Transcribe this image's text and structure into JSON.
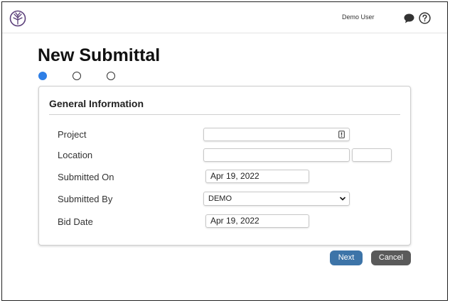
{
  "header": {
    "logo_icon": "tree-logo-icon",
    "user_name": "Demo User",
    "chat_icon": "speech-bubble-icon",
    "help_icon": "question-circle-icon"
  },
  "page": {
    "title": "New Submittal"
  },
  "steps": [
    {
      "state": "active"
    },
    {
      "state": "inactive"
    },
    {
      "state": "inactive"
    }
  ],
  "form": {
    "section_title": "General Information",
    "project": {
      "label": "Project",
      "value": "",
      "icon": "lookup-icon"
    },
    "location": {
      "label": "Location",
      "value": "",
      "value2": ""
    },
    "submitted_on": {
      "label": "Submitted On",
      "value": "Apr 19, 2022"
    },
    "submitted_by": {
      "label": "Submitted By",
      "value": "DEMO"
    },
    "bid_date": {
      "label": "Bid Date",
      "value": "Apr 19, 2022"
    }
  },
  "actions": {
    "next_label": "Next",
    "cancel_label": "Cancel"
  },
  "colors": {
    "active_step": "#2f7fe6",
    "next_button": "#3d74a8",
    "cancel_button": "#5a5a5a"
  }
}
